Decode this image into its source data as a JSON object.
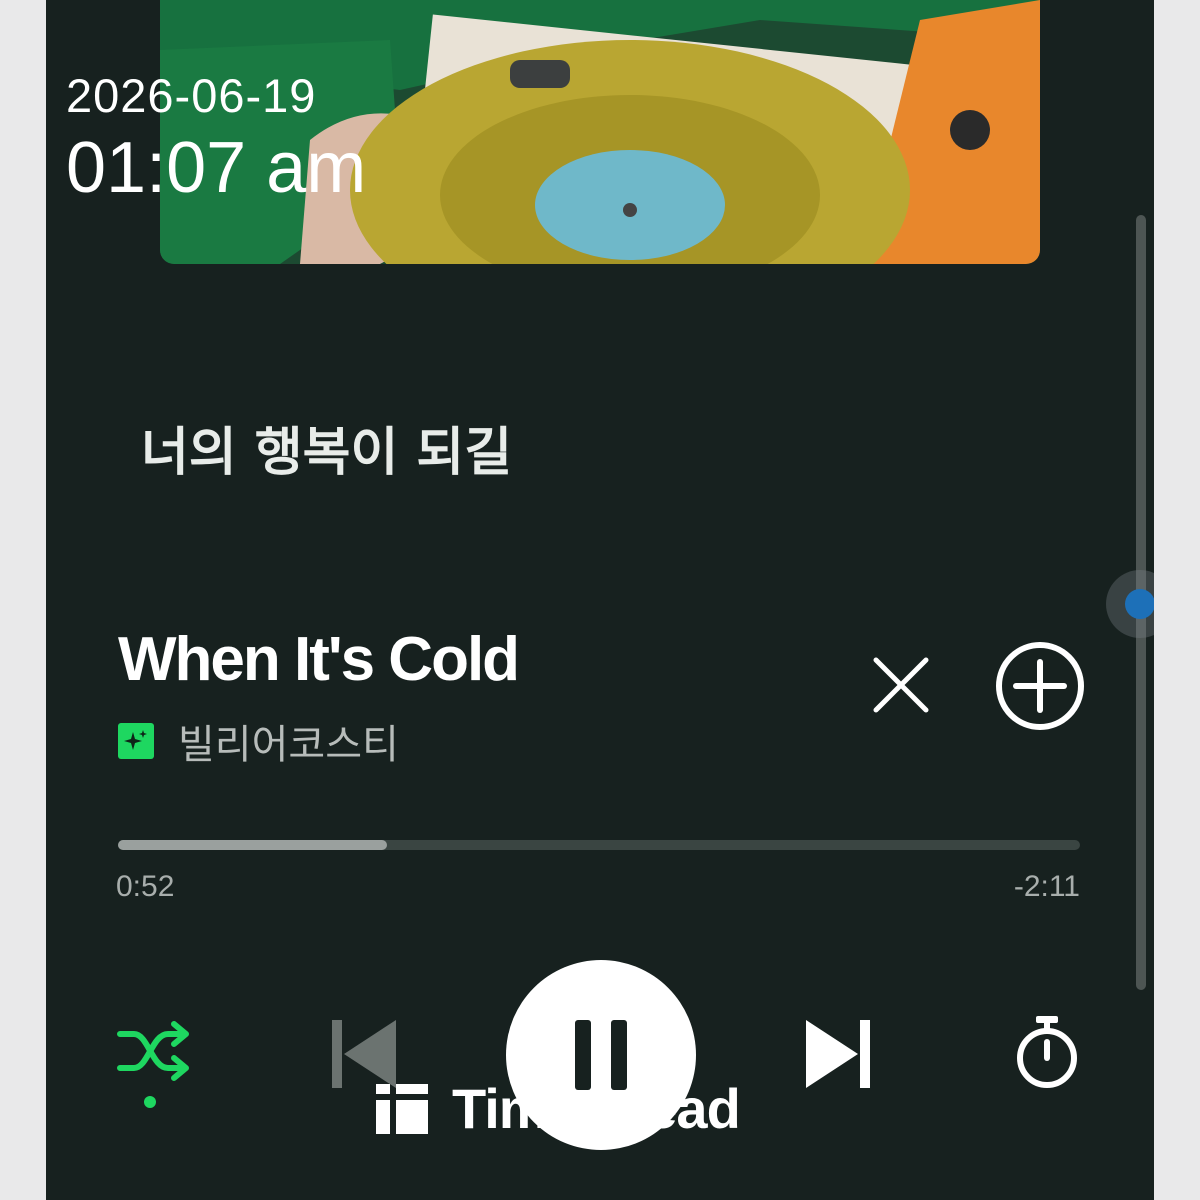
{
  "overlay": {
    "date": "2026-06-19",
    "time": "01:07 am",
    "watermark_text": "Timestread"
  },
  "album": {
    "art_icon": "album-art-image"
  },
  "lyrics": {
    "current_line": "너의 행복이 되길"
  },
  "track": {
    "title": "When It's Cold",
    "artist": "빌리어코스티",
    "artist_badge_icon": "sparkle-badge-icon"
  },
  "playback": {
    "elapsed": "0:52",
    "remaining": "-2:11",
    "progress_fraction": 0.28,
    "state": "playing"
  },
  "controls": {
    "remove_icon": "close-icon",
    "add_icon": "add-circle-icon",
    "shuffle_icon": "shuffle-icon",
    "shuffle_active": true,
    "previous_icon": "skip-previous-icon",
    "pause_icon": "pause-icon",
    "next_icon": "skip-next-icon",
    "sleep_timer_icon": "stopwatch-icon"
  },
  "colors": {
    "background": "#17211f",
    "accent_green": "#1ed760",
    "scroll_accent": "#1d70b8"
  }
}
